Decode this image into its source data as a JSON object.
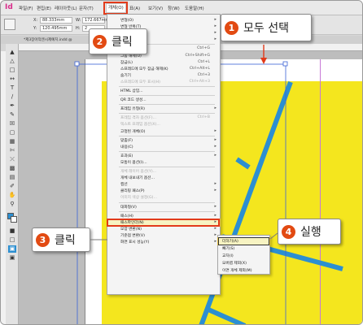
{
  "app": {
    "logo": "Id",
    "colors": {
      "accent": "#e24a12",
      "artwork_yellow": "#f4e61e",
      "artwork_blue": "#2c8fd1",
      "highlight": "#f7f3c2"
    }
  },
  "menubar": {
    "items": [
      "파일(F)",
      "편집(E)",
      "레이아웃(L)",
      "문자(T)",
      "개체(O)",
      "표(A)",
      "보기(V)",
      "창(W)",
      "도움말(H)"
    ],
    "active_index": 4
  },
  "controlbar": {
    "x_label": "X:",
    "x_value": "88.333mm",
    "y_label": "Y:",
    "y_value": "120.495mm",
    "w_label": "W:",
    "w_value": "172.667mm",
    "h_label": "H:",
    "h_value": "2"
  },
  "document_tab": {
    "title": "*제3장아작엔시제예치.indd @"
  },
  "object_menu": {
    "items": [
      {
        "label": "변형(O)",
        "shortcut": "",
        "submenu": true,
        "disabled": false
      },
      {
        "label": "변형 반복(T)",
        "shortcut": "",
        "submenu": true,
        "disabled": false
      },
      {
        "label": "정돈(A)",
        "shortcut": "",
        "submenu": true,
        "disabled": false
      },
      {
        "label": "선택(S)",
        "shortcut": "",
        "submenu": true,
        "disabled": false
      },
      {
        "separator": true
      },
      {
        "label": "그룹(G)",
        "shortcut": "Ctrl+G",
        "disabled": false
      },
      {
        "label": "그룹 해제(U)",
        "shortcut": "Ctrl+Shift+G",
        "disabled": false
      },
      {
        "label": "잠금(L)",
        "shortcut": "Ctrl+L",
        "disabled": false
      },
      {
        "label": "스프레드에 모두 잠금 해제(K)",
        "shortcut": "Ctrl+Alt+L",
        "disabled": false
      },
      {
        "label": "숨기기",
        "shortcut": "Ctrl+3",
        "disabled": false
      },
      {
        "label": "스프레드에 모두 표시(H)",
        "shortcut": "Ctrl+Alt+3",
        "disabled": true
      },
      {
        "separator": true
      },
      {
        "label": "HTML 삽입...",
        "shortcut": "",
        "disabled": false
      },
      {
        "separator": true
      },
      {
        "label": "QR 코드 생성...",
        "shortcut": "",
        "disabled": false
      },
      {
        "separator": true
      },
      {
        "label": "프레임 유형(R)",
        "shortcut": "",
        "submenu": true,
        "disabled": false
      },
      {
        "separator": true
      },
      {
        "label": "프레임 격자 옵션(F)...",
        "shortcut": "Ctrl+B",
        "disabled": true
      },
      {
        "label": "텍스트 프레임 옵션(X)...",
        "shortcut": "",
        "disabled": true
      },
      {
        "label": "고정된 개체(O)",
        "shortcut": "",
        "submenu": true,
        "disabled": false
      },
      {
        "separator": true
      },
      {
        "label": "맞춤(F)",
        "shortcut": "",
        "submenu": true,
        "disabled": false
      },
      {
        "label": "내용(C)",
        "shortcut": "",
        "submenu": true,
        "disabled": false
      },
      {
        "separator": true
      },
      {
        "label": "효과(E)",
        "shortcut": "",
        "submenu": true,
        "disabled": false
      },
      {
        "label": "모퉁이 옵션(I)...",
        "shortcut": "",
        "disabled": false
      },
      {
        "separator": true
      },
      {
        "label": "개체 레이어 옵션(Y)...",
        "shortcut": "",
        "disabled": true
      },
      {
        "label": "개체 내보내기 옵션...",
        "shortcut": "",
        "disabled": false
      },
      {
        "label": "캡션",
        "shortcut": "",
        "submenu": true,
        "disabled": false
      },
      {
        "label": "클리핑 패스(P)",
        "shortcut": "",
        "submenu": true,
        "disabled": false
      },
      {
        "label": "이미지 색상 설정(G)...",
        "shortcut": "",
        "disabled": true
      },
      {
        "separator": true
      },
      {
        "label": "대화형(V)",
        "shortcut": "",
        "submenu": true,
        "disabled": false
      },
      {
        "separator": true
      },
      {
        "label": "패스(H)",
        "shortcut": "",
        "submenu": true,
        "disabled": false
      },
      {
        "label": "패스파인더(N)",
        "shortcut": "",
        "submenu": true,
        "disabled": false,
        "highlighted": true
      },
      {
        "label": "모양 변환(N)",
        "shortcut": "",
        "submenu": true,
        "disabled": false
      },
      {
        "label": "기준점 변환(V)",
        "shortcut": "",
        "submenu": true,
        "disabled": false
      },
      {
        "label": "화면 표시 성능(Y)",
        "shortcut": "",
        "submenu": true,
        "disabled": false
      }
    ]
  },
  "pathfinder_submenu": {
    "items": [
      {
        "label": "더하기(A)",
        "highlighted": true
      },
      {
        "label": "빼기(S)"
      },
      {
        "label": "교차(I)"
      },
      {
        "label": "오버랩 제외(X)"
      },
      {
        "label": "이면 개체 제외(M)"
      }
    ]
  },
  "callouts": {
    "step1": {
      "number": "1",
      "text": "모두 선택"
    },
    "step2": {
      "number": "2",
      "text": "클릭"
    },
    "step3": {
      "number": "3",
      "text": "클릭"
    },
    "step4": {
      "number": "4",
      "text": "실행"
    }
  }
}
